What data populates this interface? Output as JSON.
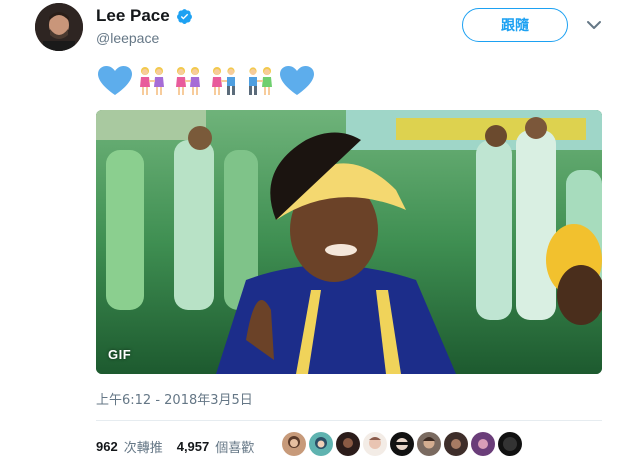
{
  "user": {
    "display_name": "Lee Pace",
    "handle": "@leepace",
    "verified": true
  },
  "follow_button": {
    "label": "跟隨"
  },
  "tweet": {
    "emoji": [
      "blue-heart",
      "women-holding-hands",
      "women-holding-hands",
      "man-and-woman-holding-hands",
      "man-and-woman-holding-hands",
      "blue-heart"
    ],
    "media": {
      "type": "gif",
      "badge": "GIF"
    },
    "timestamp": "上午6:12 - 2018年3月5日"
  },
  "stats": {
    "retweets": "962",
    "retweets_label": "次轉推",
    "likes": "4,957",
    "likes_label": "個喜歡"
  },
  "liker_avatars": 9,
  "colors": {
    "accent": "#1da1f2",
    "secondary_text": "#657786",
    "primary_text": "#14171a",
    "heart": "#5dadec"
  }
}
